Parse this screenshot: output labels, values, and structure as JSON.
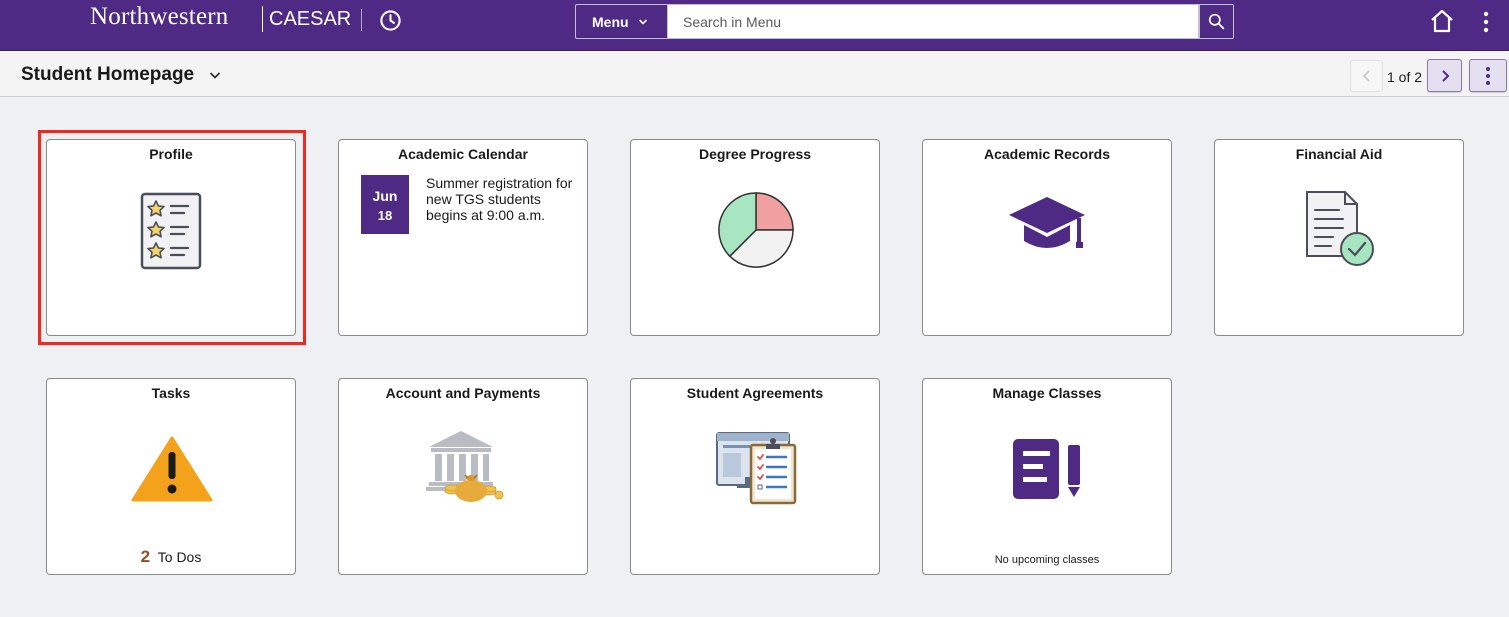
{
  "header": {
    "brand": "Northwestern",
    "app_name": "CAESAR",
    "menu_label": "Menu",
    "search_placeholder": "Search in Menu"
  },
  "subheader": {
    "page_title": "Student Homepage",
    "pager": "1 of 2"
  },
  "tiles": [
    {
      "title": "Profile",
      "icon": "profile-stars-icon"
    },
    {
      "title": "Academic Calendar",
      "month": "Jun",
      "day": "18",
      "event": "Summer registration for new TGS students begins at 9:00 a.m."
    },
    {
      "title": "Degree Progress",
      "icon": "pie-chart-icon"
    },
    {
      "title": "Academic Records",
      "icon": "graduation-cap-icon"
    },
    {
      "title": "Financial Aid",
      "icon": "document-check-icon"
    },
    {
      "title": "Tasks",
      "icon": "warning-icon",
      "count": "2",
      "count_label": "To Dos"
    },
    {
      "title": "Account and Payments",
      "icon": "bank-money-icon"
    },
    {
      "title": "Student Agreements",
      "icon": "clipboard-checklist-icon"
    },
    {
      "title": "Manage Classes",
      "icon": "form-pencil-icon",
      "note": "No upcoming classes"
    }
  ],
  "colors": {
    "brand_purple": "#4e2a84",
    "highlight_red": "#f0281e",
    "pie_green": "#a8e6c1",
    "pie_red": "#f0a0a0",
    "warning_orange": "#f4a21b"
  }
}
